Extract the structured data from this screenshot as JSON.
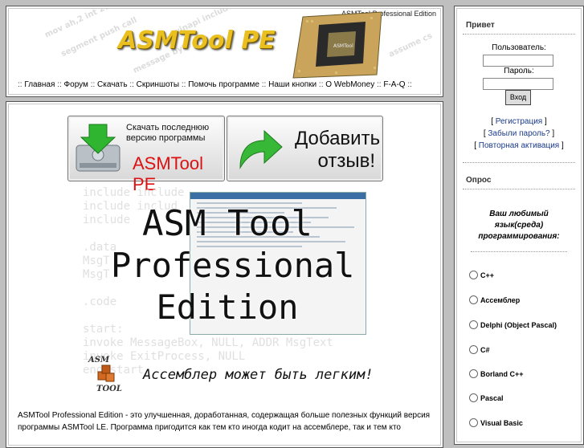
{
  "header": {
    "banner_caption": "ASMTool Professional Edition",
    "logo_text": "ASMTool PE",
    "chip_label": "ASMTool",
    "nav": [
      {
        "label": "Главная"
      },
      {
        "label": "Форум"
      },
      {
        "label": "Скачать"
      },
      {
        "label": "Скриншоты"
      },
      {
        "label": "Помочь программе"
      },
      {
        "label": "Наши кнопки"
      },
      {
        "label": "О WebMoney"
      },
      {
        "label": "F-A-Q"
      }
    ]
  },
  "main": {
    "download_cta": {
      "line1": "Скачать последнюю",
      "line2": "версию программы",
      "brand": "ASMTool PE"
    },
    "review_cta": {
      "line1": "Добавить",
      "line2": "отзыв!"
    },
    "code_bg": "include include\ninclude includ\ninclude\n\n.data\nMsgT\nMsgT\n\n.code\n\nstart:\ninvoke MessageBox, NULL, ADDR MsgText\ninvoke ExitProcess, NULL\nend start",
    "title_lines": [
      "ASM Tool",
      "Professional",
      "Edition"
    ],
    "mini_logo": {
      "top": "ASM",
      "bottom": "TOOL"
    },
    "slogan": "Ассемблер может быть легким!",
    "description": "ASMTool Professional Edition - это улучшенная, доработанная, содержащая больше полезных функций версия программы ASMTool LE. Программа пригодится как тем кто иногда кодит на ассемблере, так и тем кто"
  },
  "sidebar": {
    "greeting_title": "Привет",
    "user_label": "Пользователь:",
    "pass_label": "Пароль:",
    "login_button": "Вход",
    "links": [
      "Регистрация",
      "Забыли пароль?",
      "Повторная активация"
    ],
    "poll_title": "Опрос",
    "poll_question": "Ваш любимый язык(среда) программирования:",
    "poll_options": [
      "C++",
      "Ассемблер",
      "Delphi (Object Pascal)",
      "C#",
      "Borland C++",
      "Pascal",
      "Visual Basic"
    ]
  },
  "colors": {
    "accent": "#e9c020",
    "brand_red": "#d11111",
    "link": "#1a3a8a"
  }
}
